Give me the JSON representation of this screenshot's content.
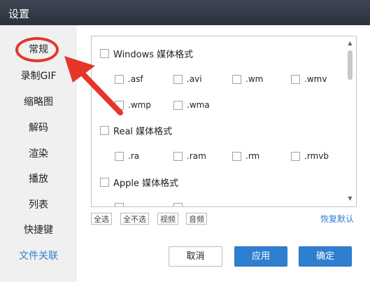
{
  "window": {
    "title": "设置"
  },
  "sidebar": {
    "items": [
      {
        "label": "常规"
      },
      {
        "label": "录制GIF"
      },
      {
        "label": "缩略图"
      },
      {
        "label": "解码"
      },
      {
        "label": "渲染"
      },
      {
        "label": "播放"
      },
      {
        "label": "列表"
      },
      {
        "label": "快捷键"
      },
      {
        "label": "文件关联"
      }
    ],
    "active_index": 8
  },
  "formats": {
    "windows": {
      "label": "Windows 媒体格式",
      "exts": [
        ".asf",
        ".avi",
        ".wm",
        ".wmv",
        ".wmp",
        ".wma"
      ]
    },
    "real": {
      "label": "Real 媒体格式",
      "exts": [
        ".ra",
        ".ram",
        ".rm",
        ".rmvb"
      ]
    },
    "apple": {
      "label": "Apple 媒体格式"
    }
  },
  "filters": {
    "all": "全选",
    "none": "全不选",
    "video": "视频",
    "audio": "音频"
  },
  "restore_default": "恢复默认",
  "buttons": {
    "cancel": "取消",
    "apply": "应用",
    "ok": "确定"
  },
  "colors": {
    "accent": "#2f7fd1",
    "annotation": "#e5362a",
    "titlebar": "#363c48"
  }
}
